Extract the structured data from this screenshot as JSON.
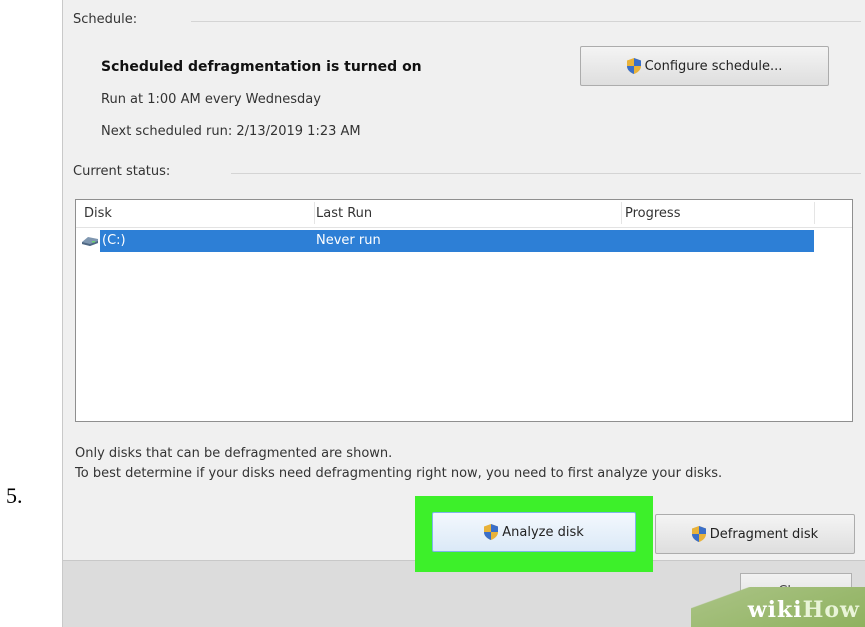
{
  "step_number": "5.",
  "schedule": {
    "label": "Schedule:",
    "heading": "Scheduled defragmentation is turned on",
    "run_time": "Run at 1:00 AM every Wednesday",
    "next_run": "Next scheduled run: 2/13/2019 1:23 AM",
    "configure_button": "Configure schedule..."
  },
  "status": {
    "label": "Current status:",
    "columns": [
      "Disk",
      "Last Run",
      "Progress"
    ],
    "rows": [
      {
        "disk": "(C:)",
        "last_run": "Never run",
        "progress": "",
        "selected": true
      }
    ]
  },
  "info": {
    "line1": "Only disks that can be defragmented are shown.",
    "line2": "To best determine if your disks need defragmenting right now, you need to first analyze your disks."
  },
  "buttons": {
    "analyze": "Analyze disk",
    "defragment": "Defragment disk",
    "close": "Close"
  },
  "watermark": {
    "part1": "wiki",
    "part2": "How"
  },
  "colors": {
    "selection": "#2d7fd6",
    "highlight": "#3df02a",
    "dialog_bg": "#f0f0f0"
  },
  "icons": [
    "shield-icon",
    "disk-drive-icon"
  ]
}
